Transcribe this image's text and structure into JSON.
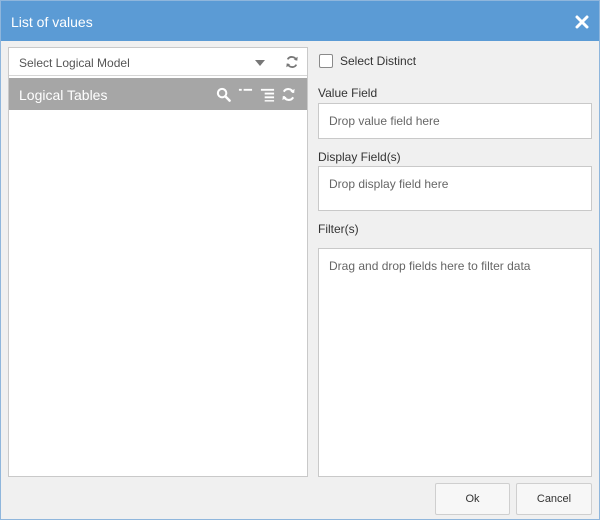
{
  "dialog": {
    "title": "List of values",
    "close_icon": "close-x-icon"
  },
  "left_panel": {
    "model_select": {
      "value": "Select Logical Model",
      "caret_icon": "caret-down-icon",
      "refresh_icon": "refresh-icon"
    },
    "tables_header": {
      "title": "Logical Tables",
      "icons": [
        "search-icon",
        "collapse-icon",
        "expand-icon",
        "refresh-icon"
      ]
    }
  },
  "right_panel": {
    "select_distinct": {
      "label": "Select Distinct",
      "checked": false
    },
    "value_field": {
      "label": "Value Field",
      "placeholder": "Drop value field here"
    },
    "display_field": {
      "label": "Display Field(s)",
      "placeholder": "Drop display field here"
    },
    "filters": {
      "label": "Filter(s)",
      "placeholder": "Drag and drop fields here to filter data"
    }
  },
  "footer": {
    "ok_label": "Ok",
    "cancel_label": "Cancel"
  },
  "colors": {
    "titlebar": "#5b9bd5",
    "tables_header": "#a6a6a6"
  }
}
